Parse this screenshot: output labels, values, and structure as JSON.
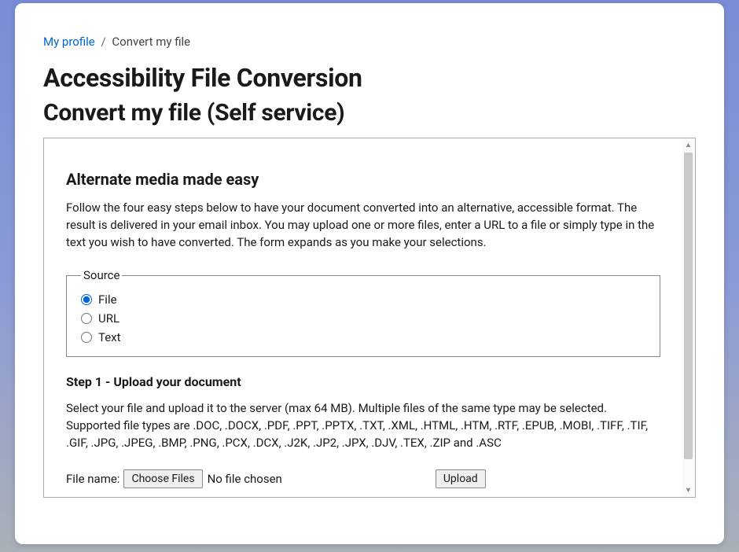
{
  "breadcrumb": {
    "root": "My profile",
    "separator": "/",
    "current": "Convert my file"
  },
  "page": {
    "title": "Accessibility File Conversion",
    "subtitle": "Convert my file (Self service)"
  },
  "panel": {
    "heading": "Alternate media made easy",
    "intro": "Follow the four easy steps below to have your document converted into an alternative, accessible format. The result is delivered in your email inbox. You may upload one or more files, enter a URL to a file or simply type in the text you wish to have converted. The form expands as you make your selections."
  },
  "source": {
    "legend": "Source",
    "options": {
      "file": "File",
      "url": "URL",
      "text": "Text"
    },
    "selected": "file"
  },
  "step1": {
    "title": "Step 1 - Upload your document",
    "description": "Select your file and upload it to the server (max 64 MB). Multiple files of the same type may be selected. Supported file types are .DOC, .DOCX, .PDF, .PPT, .PPTX, .TXT, .XML, .HTML, .HTM, .RTF, .EPUB, .MOBI, .TIFF, .TIF, .GIF, .JPG, .JPEG, .BMP, .PNG, .PCX, .DCX, .J2K, .JP2, .JPX, .DJV, .TEX, .ZIP and .ASC",
    "file_label": "File name:",
    "choose_button": "Choose Files",
    "file_status": "No file chosen",
    "upload_button": "Upload"
  }
}
